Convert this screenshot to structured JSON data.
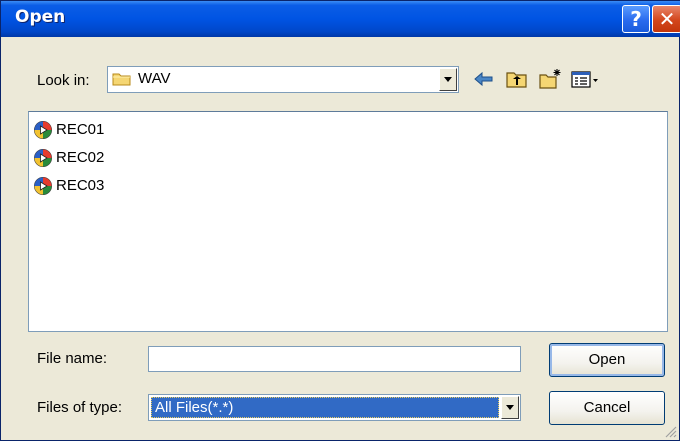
{
  "window": {
    "title": "Open",
    "help_glyph": "?",
    "close_glyph": "✕"
  },
  "lookin": {
    "label": "Look in:",
    "value": "WAV"
  },
  "toolbar": {
    "icons": [
      "back-arrow-icon",
      "up-folder-icon",
      "new-folder-icon",
      "view-menu-icon"
    ]
  },
  "files": [
    {
      "name": "REC01",
      "icon": "media-file-icon"
    },
    {
      "name": "REC02",
      "icon": "media-file-icon"
    },
    {
      "name": "REC03",
      "icon": "media-file-icon"
    }
  ],
  "filename": {
    "label": "File name:",
    "value": ""
  },
  "filetype": {
    "label": "Files of type:",
    "value": "All Files(*.*)"
  },
  "buttons": {
    "open": "Open",
    "cancel": "Cancel"
  },
  "colors": {
    "title_bar": "#0054e3",
    "selection": "#316ac5",
    "dialog_bg": "#ece9d8"
  }
}
